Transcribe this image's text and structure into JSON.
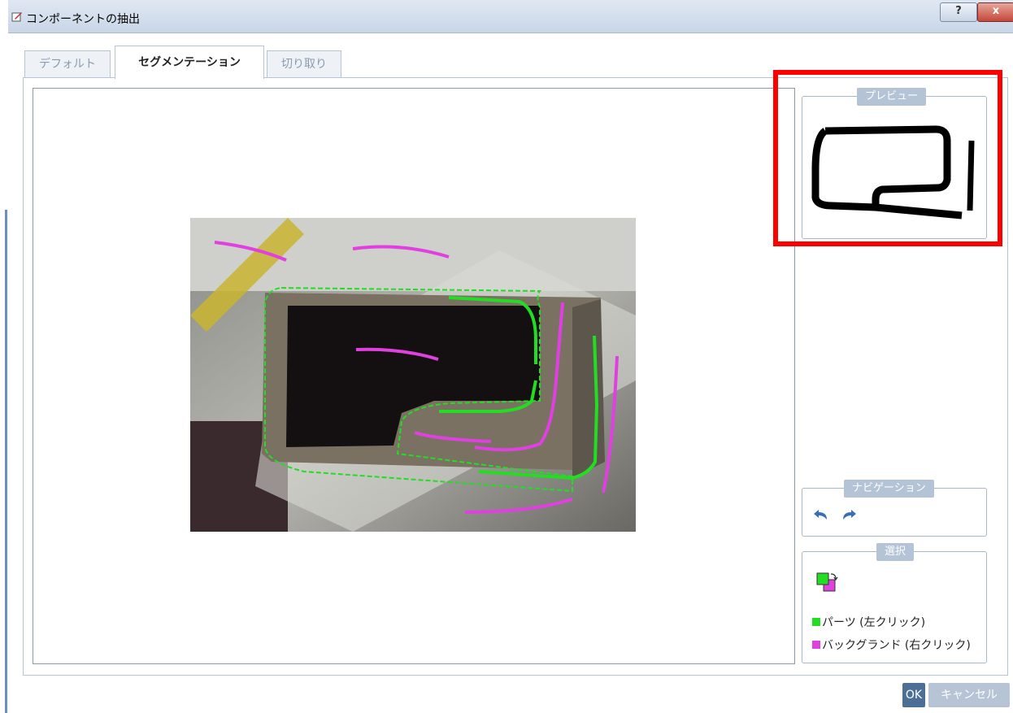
{
  "window": {
    "title": "コンポーネントの抽出",
    "help_label": "?",
    "close_label": "x"
  },
  "tabs": [
    {
      "label": "デフォルト",
      "active": false
    },
    {
      "label": "セグメンテーション",
      "active": true
    },
    {
      "label": "切り取り",
      "active": false
    }
  ],
  "preview": {
    "title": "プレビュー"
  },
  "navigation": {
    "title": "ナビゲーション",
    "undo_icon": "undo-icon",
    "redo_icon": "redo-icon"
  },
  "selection": {
    "title": "選択",
    "swap_icon": "swap-colors-icon",
    "part_label": "パーツ (左クリック)",
    "background_label": "バックグランド (右クリック)",
    "part_color": "#22dd22",
    "background_color": "#e040e0"
  },
  "buttons": {
    "ok": "OK",
    "cancel": "キャンセル"
  },
  "colors": {
    "highlight": "#ff0000",
    "group_title": "#b4c3d6",
    "ok_button": "#4d6f95"
  }
}
